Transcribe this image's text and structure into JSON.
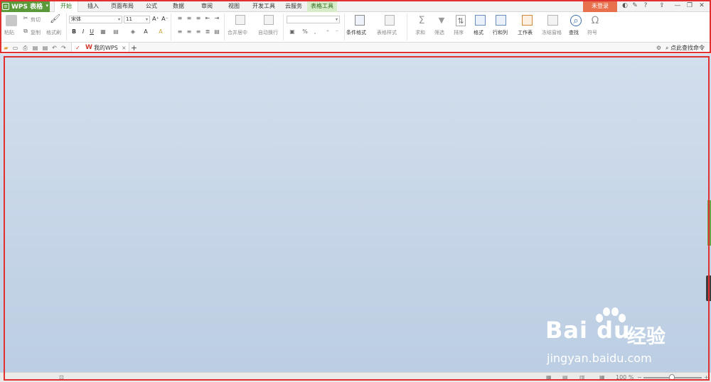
{
  "app": {
    "title": "WPS 表格",
    "logo_glyph": "≡",
    "drop_glyph": "▾"
  },
  "tabs": [
    {
      "label": "开始"
    },
    {
      "label": "插入"
    },
    {
      "label": "页面布局"
    },
    {
      "label": "公式"
    },
    {
      "label": "数据"
    },
    {
      "label": "审阅"
    },
    {
      "label": "视图"
    },
    {
      "label": "开发工具"
    },
    {
      "label": "云服务"
    },
    {
      "label": "表格工具"
    }
  ],
  "header": {
    "login_label": "未登录",
    "icons": {
      "help": "?",
      "minimize": "—",
      "restore": "❐",
      "close": "✕",
      "upload": "⇪",
      "skin": "◐",
      "feedback": "✎"
    }
  },
  "ribbon": {
    "clipboard": {
      "paste": "粘贴",
      "cut": "剪切",
      "copy": "复制",
      "format_painter": "格式刷"
    },
    "font": {
      "name": "宋体",
      "size": "11",
      "bold": "B",
      "italic": "I",
      "underline": "U",
      "grow": "A⁺",
      "shrink": "A⁻"
    },
    "alignment": {
      "merge": "合并居中",
      "wrap": "自动换行"
    },
    "number": {
      "format_value": "",
      "percent": "%",
      "comma": "‚"
    },
    "styles": {
      "conditional": "条件格式",
      "table_style": "表格样式"
    },
    "editing": {
      "sum": "求和",
      "filter": "筛选",
      "sort": "排序",
      "format": "格式",
      "rows_cols": "行和列",
      "worksheet": "工作表",
      "freeze": "冻结窗格",
      "find": "查找",
      "symbol": "符号"
    },
    "glyphs": {
      "sigma": "Σ",
      "funnel": "▼",
      "sort": "⇅",
      "omega": "Ω",
      "search": "⌕",
      "drop": "▾"
    }
  },
  "quickbar": {
    "doc_tab": "我的WPS",
    "doc_logo": "W",
    "close": "×",
    "new_tab": "+",
    "search_command": "点此查找命令",
    "glyphs": {
      "open": "▰",
      "save": "▭",
      "print": "⎙",
      "preview": "▤",
      "undo": "↶",
      "redo": "↷",
      "custom": "✓",
      "search": "⌕",
      "settings": "⚙"
    }
  },
  "status": {
    "zoom": "100 %",
    "zoom_minus": "−",
    "zoom_plus": "+",
    "view_icons": [
      "▦",
      "▤",
      "▥"
    ],
    "left_icon": "⊡"
  },
  "watermark": {
    "brand": "Bai du",
    "brand_cn": "经验",
    "url": "jingyan.baidu.com"
  }
}
